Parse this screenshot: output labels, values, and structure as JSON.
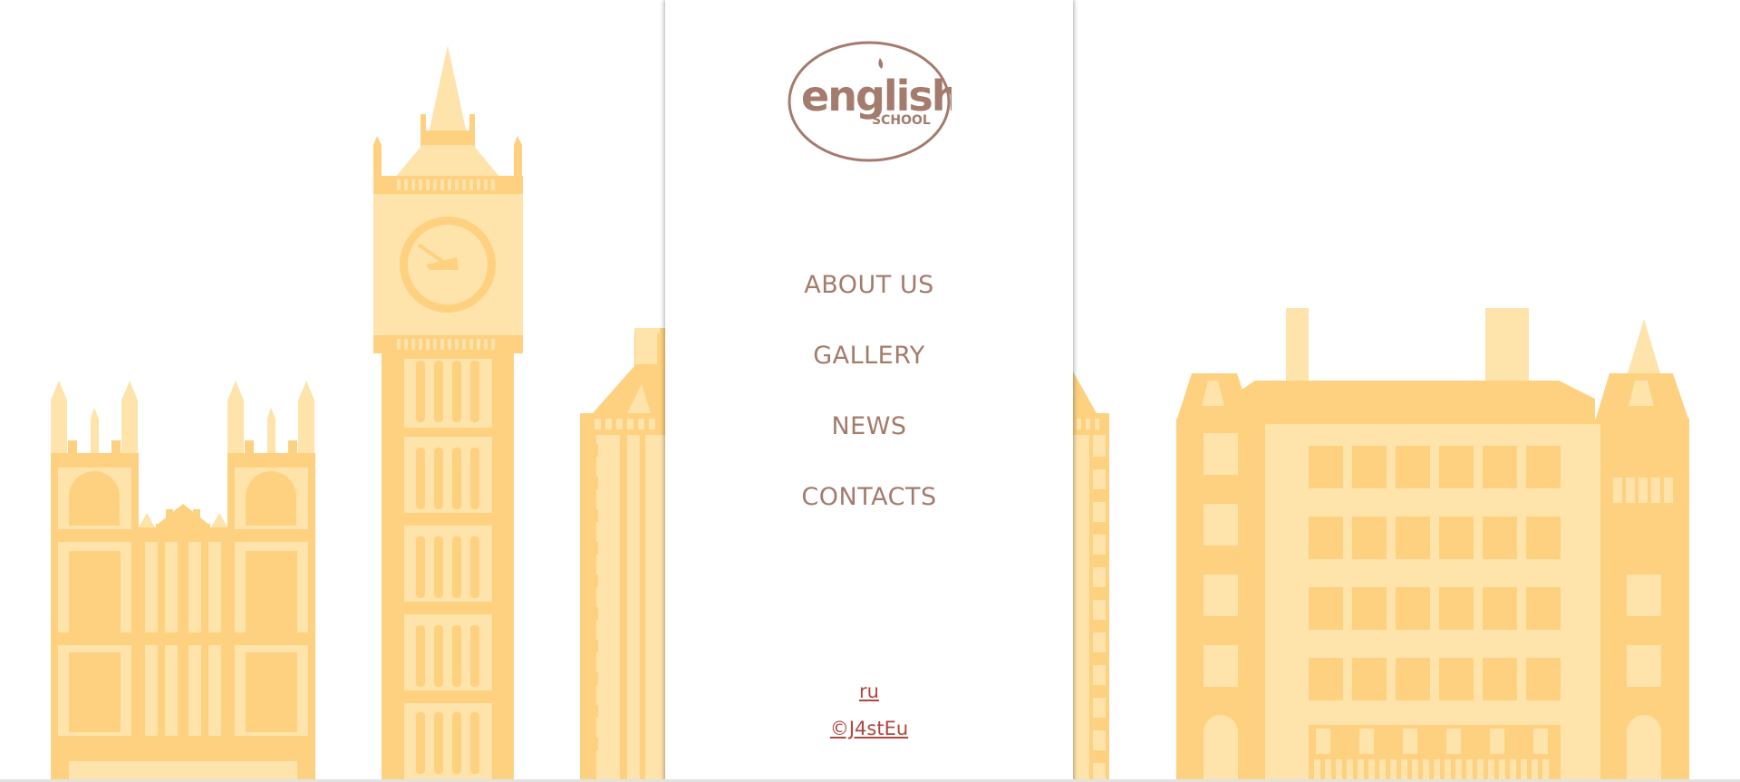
{
  "logo": {
    "word": "english",
    "subword": "SCHOOL"
  },
  "nav": {
    "items": [
      {
        "label": "ABOUT US"
      },
      {
        "label": "GALLERY"
      },
      {
        "label": "NEWS"
      },
      {
        "label": "CONTACTS"
      }
    ]
  },
  "footer": {
    "language_link": "ru",
    "copyright_link": "©J4stEu"
  },
  "colors": {
    "building_dark": "#fdd17f",
    "building_light": "#fee3ab",
    "nav_text": "#a47b6c",
    "footer_link": "#b0463d",
    "logo_brown": "#a47b6c"
  }
}
